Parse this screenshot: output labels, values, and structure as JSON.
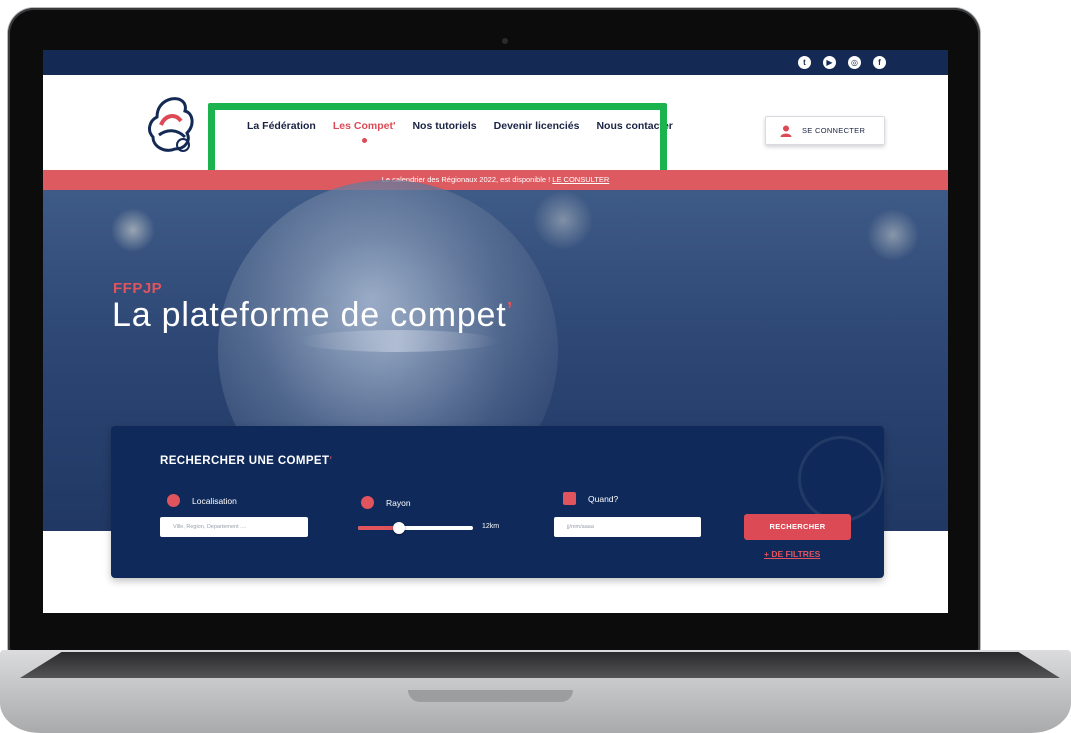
{
  "social": {
    "icons": [
      "twitter-icon",
      "youtube-icon",
      "instagram-icon",
      "facebook-icon"
    ],
    "glyphs": [
      "t",
      "▶",
      "◎",
      "f"
    ]
  },
  "nav": {
    "items": [
      {
        "label": "La Fédération"
      },
      {
        "label": "Les Compet'"
      },
      {
        "label": "Nos tutoriels"
      },
      {
        "label": "Devenir licenciés"
      },
      {
        "label": "Nous contacter"
      }
    ],
    "active_index": 1
  },
  "account": {
    "connect_label": "SE CONNECTER"
  },
  "banner": {
    "text": "Le calendrier des Régionaux 2022, est disponible ! ",
    "link": "LE CONSULTER"
  },
  "hero": {
    "label": "FFPJP",
    "title": "La plateforme de compet",
    "title_tick": "’"
  },
  "search": {
    "title": "RECHERCHER UNE COMPET",
    "title_tick": "’",
    "location": {
      "label": "Localisation",
      "placeholder": "Ville, Region, Departement ...."
    },
    "radius": {
      "label": "Rayon",
      "value": "12km",
      "fraction": 0.36
    },
    "date": {
      "label": "Quand?",
      "placeholder": "jj/mm/aaaa"
    },
    "submit_label": "RECHERCHER",
    "filters_label": "+ DE FILTRES"
  },
  "colors": {
    "navy": "#142a55",
    "accent_red": "#dc4a55",
    "highlight_green": "#1bb34d"
  }
}
